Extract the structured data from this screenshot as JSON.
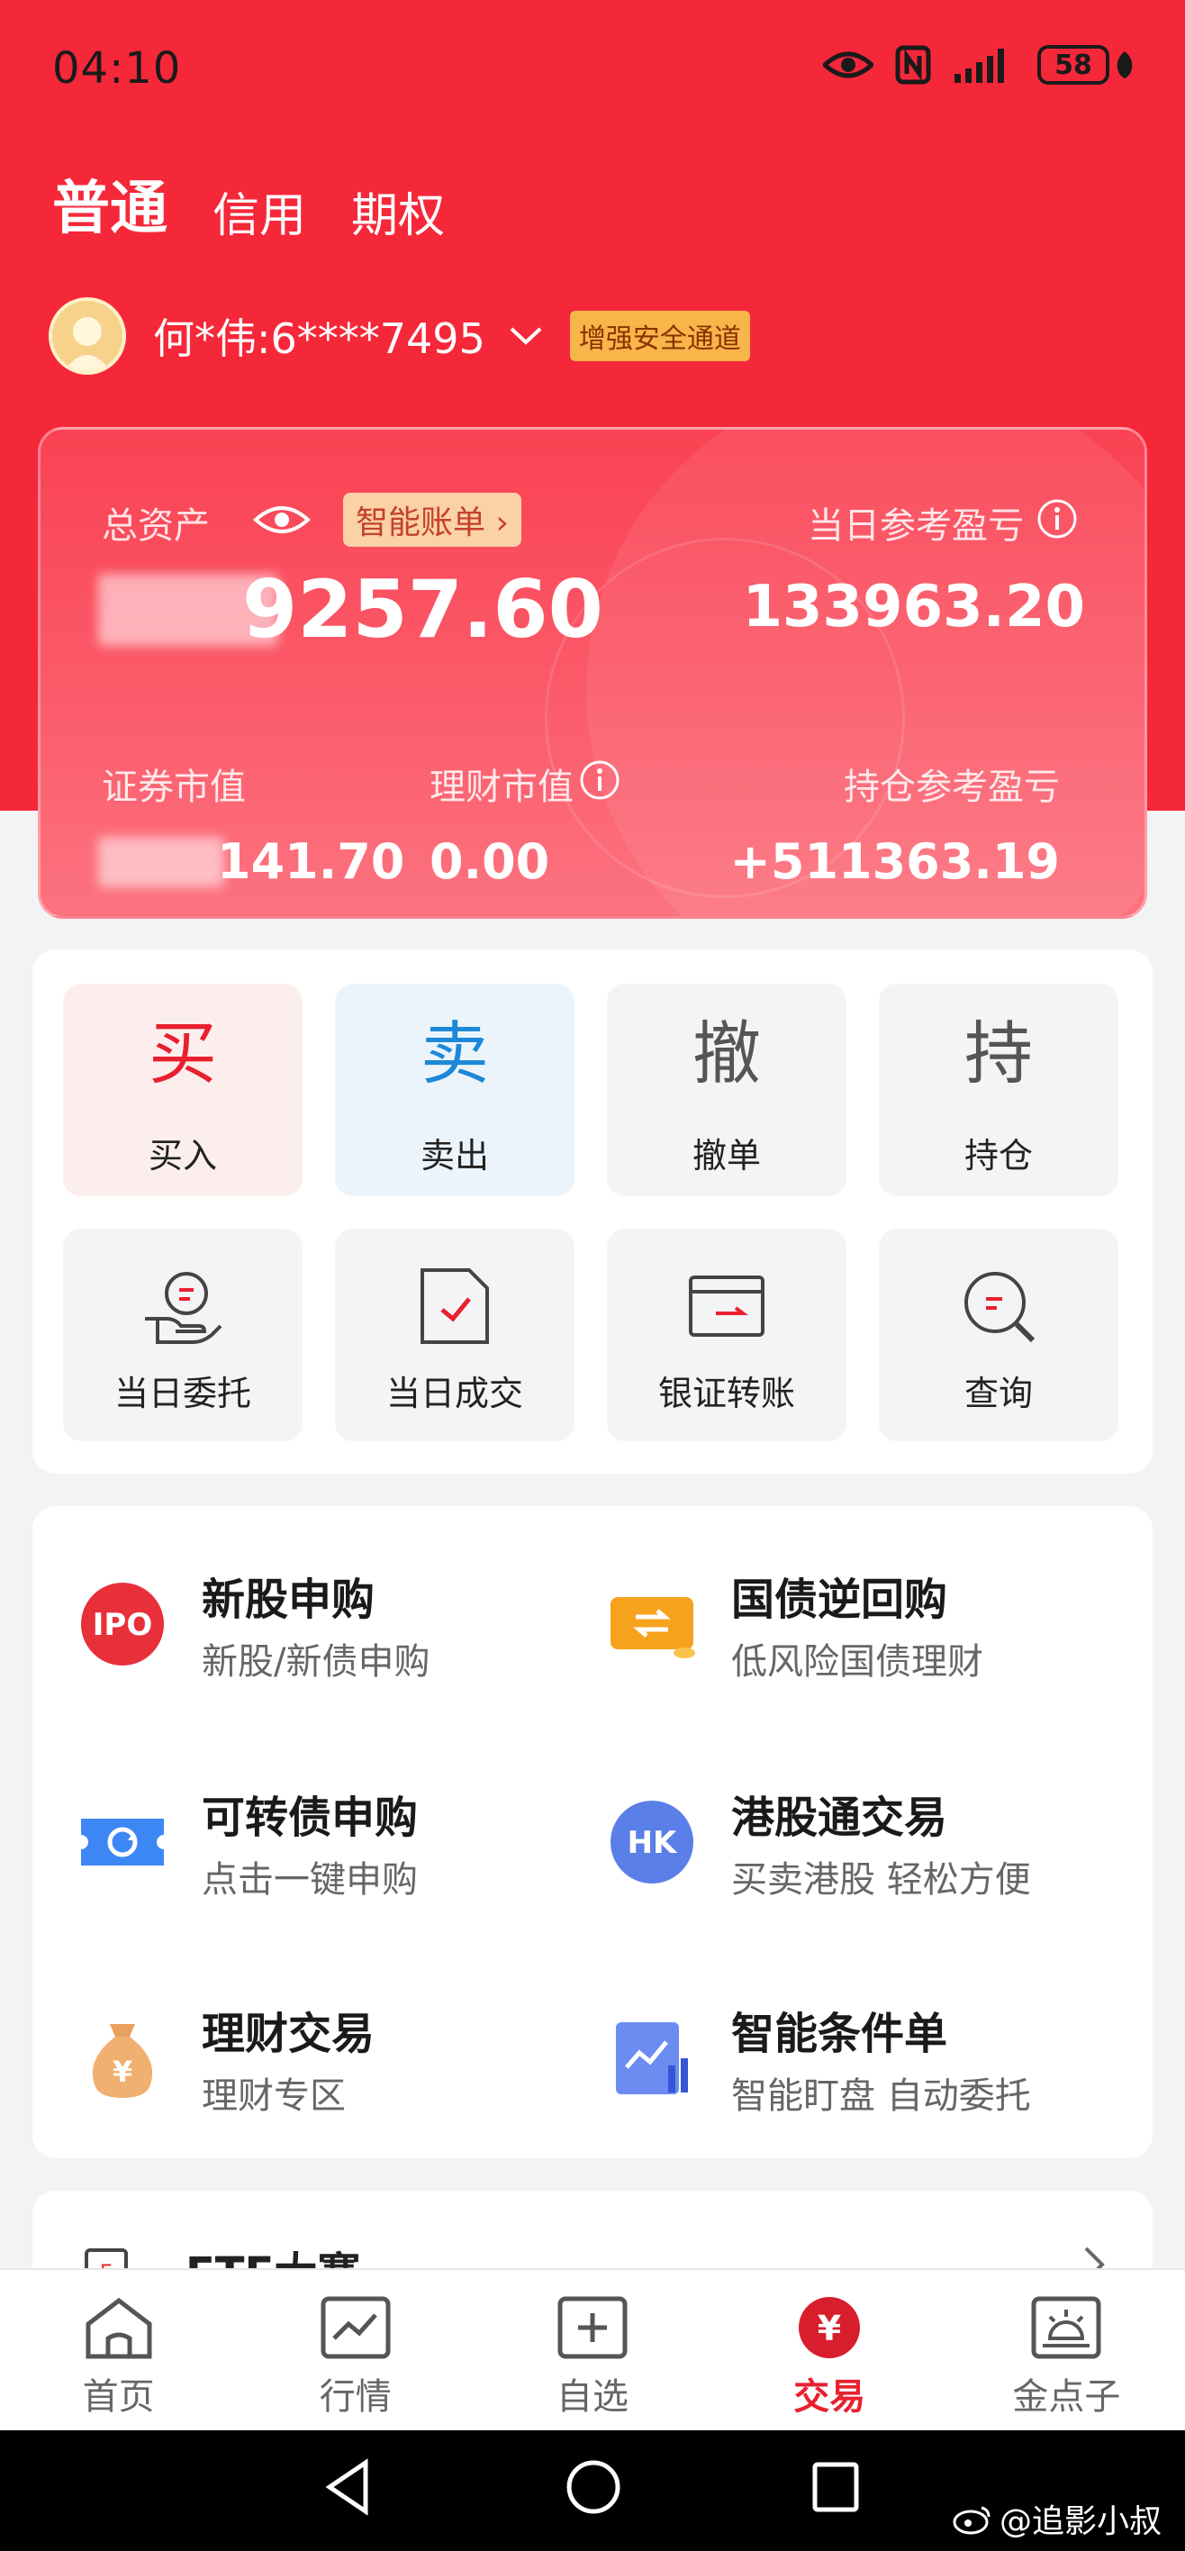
{
  "status_bar": {
    "time": "04:10",
    "battery": "58"
  },
  "account_tabs": [
    "普通",
    "信用",
    "期权"
  ],
  "user": {
    "name": "何*伟:6****7495",
    "secure_badge": "增强安全通道"
  },
  "assets": {
    "total_label": "总资产",
    "smart_bill": "智能账单",
    "total_value": "9257.60",
    "daily_pl_label": "当日参考盈亏",
    "daily_pl_value": "133963.20",
    "securities_label": "证券市值",
    "securities_value": "141.70",
    "wealth_label": "理财市值",
    "wealth_value": "0.00",
    "position_pl_label": "持仓参考盈亏",
    "position_pl_value": "+511363.19"
  },
  "quick_actions": [
    {
      "glyph": "买",
      "label": "买入",
      "color": "#e8202f"
    },
    {
      "glyph": "卖",
      "label": "卖出",
      "color": "#1e88d8"
    },
    {
      "glyph": "撤",
      "label": "撤单",
      "color": "#555555"
    },
    {
      "glyph": "持",
      "label": "持仓",
      "color": "#555555"
    },
    {
      "icon": "hand-coin-icon",
      "label": "当日委托"
    },
    {
      "icon": "checked-doc-icon",
      "label": "当日成交"
    },
    {
      "icon": "card-transfer-icon",
      "label": "银证转账"
    },
    {
      "icon": "search-doc-icon",
      "label": "查询"
    }
  ],
  "services": [
    {
      "icon": "ipo-icon",
      "icon_text": "IPO",
      "title": "新股申购",
      "subtitle": "新股/新债申购"
    },
    {
      "icon": "repo-icon",
      "title": "国债逆回购",
      "subtitle": "低风险国债理财"
    },
    {
      "icon": "convertible-bond-icon",
      "title": "可转债申购",
      "subtitle": "点击一键申购"
    },
    {
      "icon": "hk-icon",
      "icon_text": "HK",
      "title": "港股通交易",
      "subtitle": "买卖港股 轻松方便"
    },
    {
      "icon": "money-bag-icon",
      "icon_text": "¥",
      "title": "理财交易",
      "subtitle": "理财专区"
    },
    {
      "icon": "smart-order-icon",
      "title": "智能条件单",
      "subtitle": "智能盯盘 自动委托"
    }
  ],
  "partial_card": {
    "title": "ETF大赛"
  },
  "tabs": [
    {
      "label": "首页",
      "icon": "home-icon"
    },
    {
      "label": "行情",
      "icon": "chart-icon"
    },
    {
      "label": "自选",
      "icon": "add-icon"
    },
    {
      "label": "交易",
      "icon": "trade-yen-icon",
      "icon_text": "¥",
      "active": true
    },
    {
      "label": "金点子",
      "icon": "idea-icon"
    }
  ],
  "watermark": "@追影小叔",
  "colors": {
    "brand_red": "#f5283a",
    "active_tab": "#e8202f"
  }
}
